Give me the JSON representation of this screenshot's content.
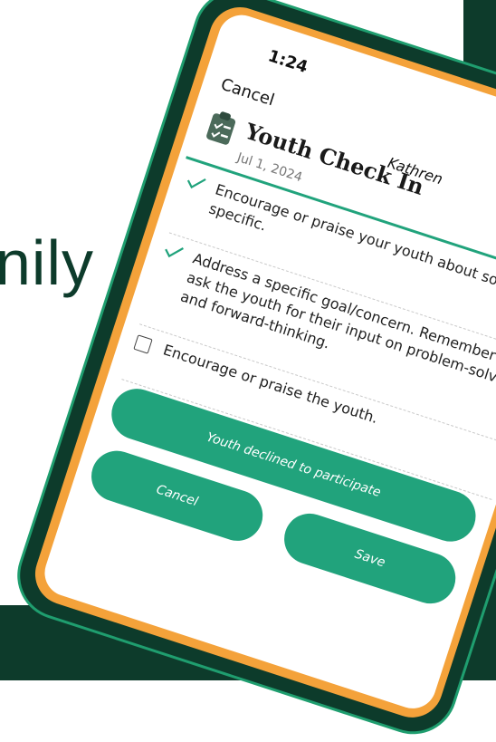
{
  "background": {
    "partial_word": "nily",
    "colors": {
      "dark_green": "#0d3b2b",
      "accent_teal": "#21a37c",
      "bezel_orange": "#f4a23a"
    }
  },
  "status_bar": {
    "time": "1:24"
  },
  "header": {
    "cancel_label": "Cancel",
    "user_name": "Kathren",
    "title": "Youth Check In",
    "date": "Jul 1, 2024",
    "icon": "clipboard-check-icon"
  },
  "checklist": [
    {
      "checked": true,
      "text": "Encourage or praise your youth about something specific."
    },
    {
      "checked": true,
      "text": "Address a specific goal/concern. Remember to ask the youth for their input on problem-solving and forward-thinking."
    },
    {
      "checked": false,
      "text": "Encourage or praise the youth."
    }
  ],
  "buttons": {
    "declined_label": "Youth declined to participate",
    "cancel_label": "Cancel",
    "save_label": "Save"
  }
}
